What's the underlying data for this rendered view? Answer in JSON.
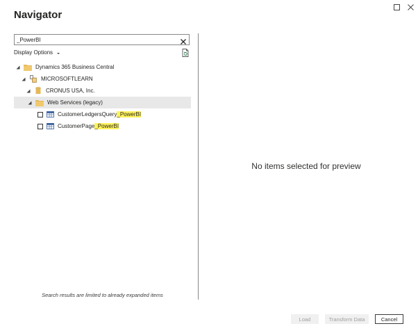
{
  "window": {
    "title": "Navigator",
    "maximize_icon": "maximize-icon",
    "close_icon": "close-icon"
  },
  "search": {
    "value": "_PowerBI",
    "clear_icon": "clear-icon"
  },
  "display_options": {
    "label": "Display Options",
    "caret_icon": "caret-down-icon",
    "refresh_icon": "refresh-document-icon"
  },
  "tree": {
    "root": {
      "label": "Dynamics 365 Business Central",
      "icon": "folder-icon"
    },
    "environment": {
      "label": "MICROSOFTLEARN",
      "icon": "environment-icon"
    },
    "company": {
      "label": "CRONUS USA, Inc.",
      "icon": "database-icon"
    },
    "group": {
      "label": "Web Services (legacy)",
      "icon": "folder-icon"
    },
    "items": [
      {
        "prefix": "CustomerLedgersQuery",
        "match": "_PowerBI",
        "icon": "table-icon",
        "checked": false
      },
      {
        "prefix": "CustomerPage",
        "match": "_PowerBI",
        "icon": "table-icon",
        "checked": false
      }
    ]
  },
  "search_note": "Search results are limited to already expanded items",
  "preview": {
    "empty_message": "No items selected for preview"
  },
  "buttons": {
    "load": "Load",
    "transform": "Transform Data",
    "cancel": "Cancel"
  },
  "colors": {
    "highlight": "#fff35c",
    "folder": "#e6b85c",
    "divider": "#8a8886"
  }
}
